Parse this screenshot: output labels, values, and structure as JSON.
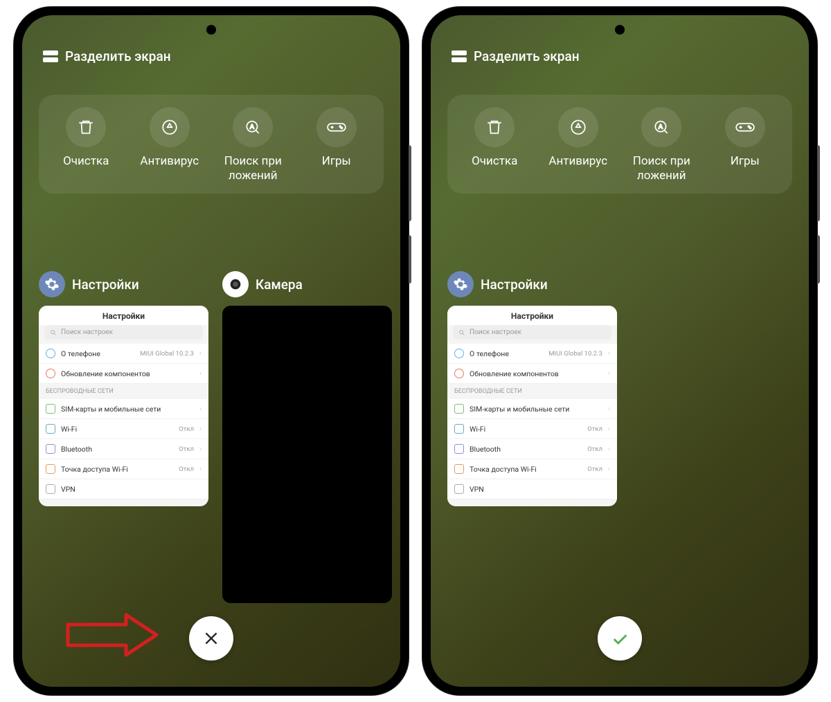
{
  "split_screen_label": "Разделить экран",
  "tools": [
    {
      "label": "Очистка",
      "icon": "trash"
    },
    {
      "label": "Антивирус",
      "icon": "shield"
    },
    {
      "label": "Поиск при\nложений",
      "icon": "search"
    },
    {
      "label": "Игры",
      "icon": "gamepad"
    }
  ],
  "apps": {
    "settings": {
      "title": "Настройки",
      "thumb": {
        "heading": "Настройки",
        "search_placeholder": "Поиск настроек",
        "rows_top": [
          {
            "label": "О телефоне",
            "value": "MIUI Global 10.2.3"
          },
          {
            "label": "Обновление компонентов",
            "value": ""
          }
        ],
        "section": "БЕСПРОВОДНЫЕ СЕТИ",
        "rows_net": [
          {
            "label": "SIM-карты и мобильные сети",
            "value": ""
          },
          {
            "label": "Wi-Fi",
            "value": "Откл"
          },
          {
            "label": "Bluetooth",
            "value": "Откл"
          },
          {
            "label": "Точка доступа Wi-Fi",
            "value": "Откл"
          },
          {
            "label": "VPN",
            "value": ""
          }
        ]
      }
    },
    "camera": {
      "title": "Камера"
    }
  },
  "bottom_button": {
    "left": "close",
    "right": "check"
  },
  "colors": {
    "accent_green": "#4caf50",
    "arrow_red": "#d32020"
  }
}
